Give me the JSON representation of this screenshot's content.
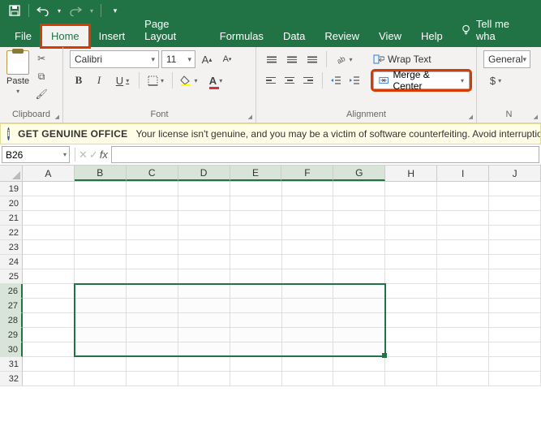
{
  "quickaccess": {
    "save": "save-icon",
    "undo": "undo-icon",
    "redo": "redo-icon"
  },
  "tabs": {
    "file": "File",
    "home": "Home",
    "insert": "Insert",
    "pagelayout": "Page Layout",
    "formulas": "Formulas",
    "data": "Data",
    "review": "Review",
    "view": "View",
    "help": "Help",
    "tell": "Tell me wha"
  },
  "ribbon": {
    "clipboard": {
      "paste": "Paste",
      "label": "Clipboard"
    },
    "font": {
      "name": "Calibri",
      "size": "11",
      "bold": "B",
      "italic": "I",
      "underline": "U",
      "label": "Font"
    },
    "alignment": {
      "wrap": "Wrap Text",
      "merge": "Merge & Center",
      "label": "Alignment"
    },
    "number": {
      "format": "General",
      "currency": "$",
      "label": "N"
    }
  },
  "messagebar": {
    "title": "GET GENUINE OFFICE",
    "body": "Your license isn't genuine, and you may be a victim of software counterfeiting. Avoid interruptio"
  },
  "namebox": "B26",
  "columns": [
    "A",
    "B",
    "C",
    "D",
    "E",
    "F",
    "G",
    "H",
    "I",
    "J"
  ],
  "rows": [
    "19",
    "20",
    "21",
    "22",
    "23",
    "24",
    "25",
    "26",
    "27",
    "28",
    "29",
    "30",
    "31",
    "32"
  ],
  "selection": {
    "cols": [
      "B",
      "C",
      "D",
      "E",
      "F",
      "G"
    ],
    "rows": [
      "26",
      "27",
      "28",
      "29",
      "30"
    ]
  }
}
